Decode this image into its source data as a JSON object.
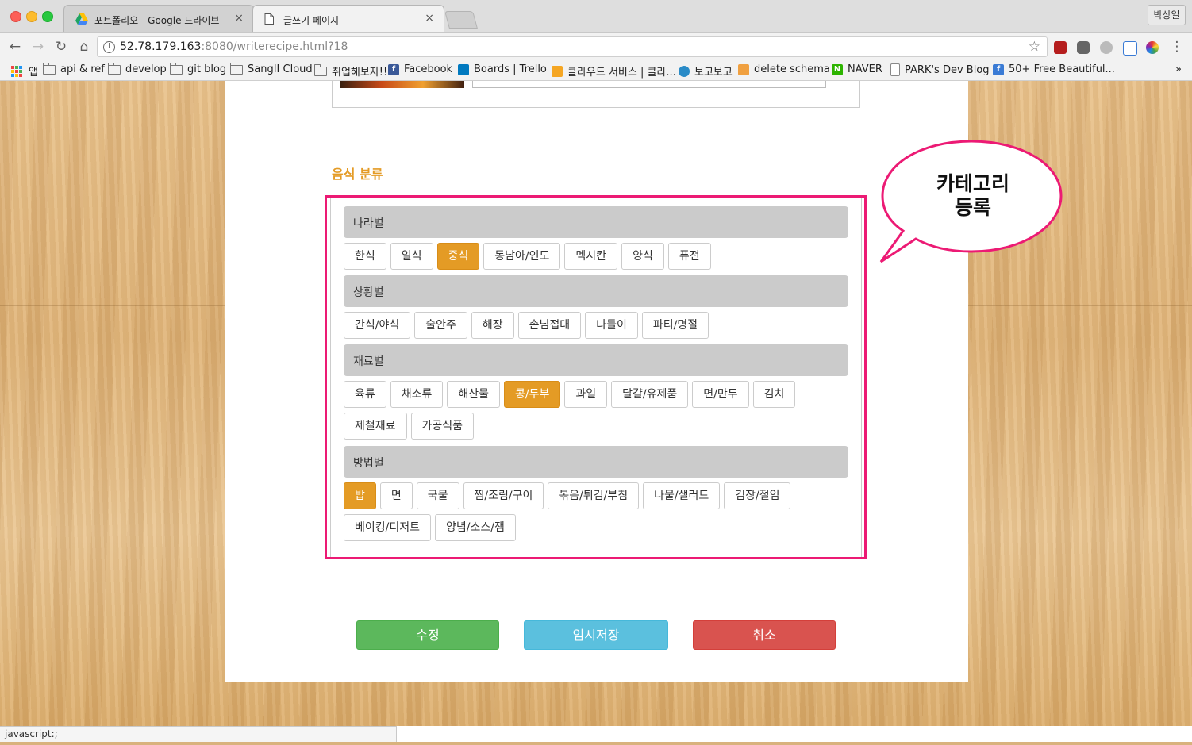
{
  "browser": {
    "tabs": [
      {
        "title": "포트폴리오 - Google 드라이브",
        "close": "×"
      },
      {
        "title": "글쓰기 페이지",
        "close": "×"
      }
    ],
    "profile": "박상일",
    "url_host": "52.78.179.163",
    "url_rest": ":8080/writerecipe.html?18",
    "info_glyph": "i",
    "star_glyph": "☆",
    "menu_glyph": "⋮",
    "nav": {
      "back": "←",
      "forward": "→",
      "reload": "↻",
      "home": "⌂"
    },
    "bookmarks": [
      "앱",
      "api & ref",
      "develop",
      "git blog",
      "SangII Cloud",
      "취업해보자!!",
      "Facebook",
      "Boards | Trello",
      "클라우드 서비스 | 클라...",
      "보고보고",
      "delete schema",
      "NAVER",
      "PARK's Dev Blog",
      "50+ Free Beautiful..."
    ],
    "bookmarks_more": "»",
    "status_text": "javascript:;"
  },
  "section_title": "음식 분류",
  "categories": [
    {
      "header": "나라별",
      "items": [
        "한식",
        "일식",
        "중식",
        "동남아/인도",
        "멕시칸",
        "양식",
        "퓨전"
      ],
      "selected": [
        "중식"
      ]
    },
    {
      "header": "상황별",
      "items": [
        "간식/야식",
        "술안주",
        "해장",
        "손님접대",
        "나들이",
        "파티/명절"
      ],
      "selected": []
    },
    {
      "header": "재료별",
      "items": [
        "육류",
        "채소류",
        "해산물",
        "콩/두부",
        "과일",
        "달걀/유제품",
        "면/만두",
        "김치",
        "제철재료",
        "가공식품"
      ],
      "selected": [
        "콩/두부"
      ]
    },
    {
      "header": "방법별",
      "items": [
        "밥",
        "면",
        "국물",
        "찜/조림/구이",
        "볶음/튀김/부침",
        "나물/샐러드",
        "김장/절임",
        "베이킹/디저트",
        "양념/소스/잼"
      ],
      "selected": [
        "밥"
      ]
    }
  ],
  "annotation": {
    "line1": "카테고리",
    "line2": "등록",
    "color": "#ec1a74"
  },
  "buttons": {
    "edit": "수정",
    "temp_save": "임시저장",
    "cancel": "취소"
  },
  "colors": {
    "accent": "#e49b25",
    "success": "#5cb85c",
    "info": "#5bc0de",
    "danger": "#d9534f"
  }
}
